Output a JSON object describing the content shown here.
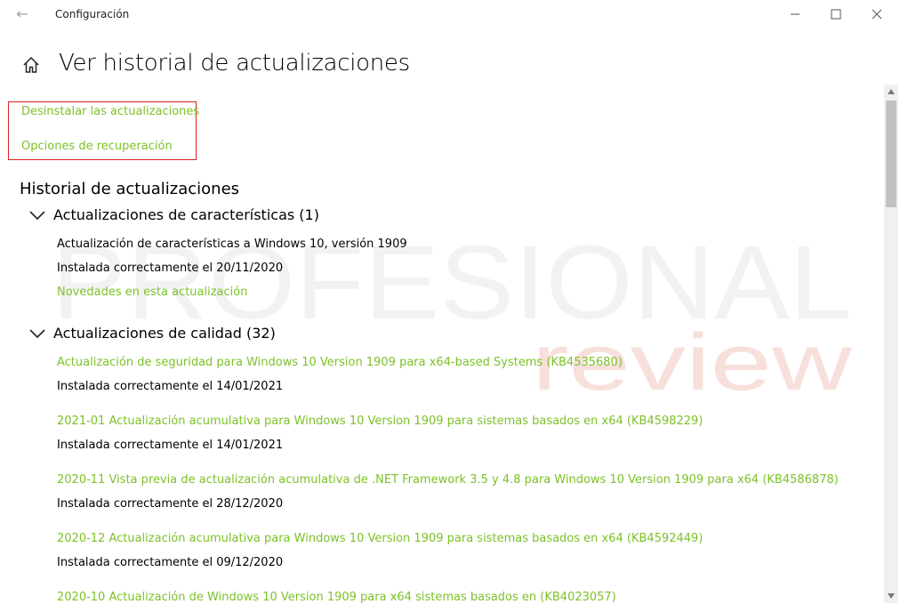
{
  "window": {
    "title": "Configuración",
    "back_icon": "←",
    "controls": [
      "minimize-icon",
      "maximize-icon",
      "close-icon"
    ]
  },
  "header": {
    "home_icon": "home-icon",
    "title": "Ver historial de actualizaciones"
  },
  "links": {
    "uninstall": "Desinstalar las actualizaciones",
    "recovery": "Opciones de recuperación",
    "highlight_color": "#e02020"
  },
  "history": {
    "title": "Historial de actualizaciones",
    "features": {
      "label": "Actualizaciones de características (1)",
      "items": [
        {
          "name": "Actualización de características a Windows 10, versión 1909",
          "status": "Instalada correctamente el 20/11/2020",
          "link": "Novedades en esta actualización"
        }
      ]
    },
    "quality": {
      "label": "Actualizaciones de calidad (32)",
      "items": [
        {
          "name": "Actualización de seguridad para Windows 10 Version 1909 para x64-based Systems (KB4535680)",
          "status": "Instalada correctamente el 14/01/2021"
        },
        {
          "name": "2021-01 Actualización acumulativa para Windows 10 Version 1909 para sistemas basados en x64 (KB4598229)",
          "status": "Instalada correctamente el 14/01/2021"
        },
        {
          "name": "2020-11 Vista previa de actualización acumulativa de .NET Framework 3.5 y 4.8 para Windows 10 Version 1909 para x64 (KB4586878)",
          "status": "Instalada correctamente el 28/12/2020"
        },
        {
          "name": "2020-12 Actualización acumulativa para Windows 10 Version 1909 para sistemas basados en x64 (KB4592449)",
          "status": "Instalada correctamente el 09/12/2020"
        },
        {
          "name": "2020-10 Actualización de Windows 10 Version 1909 para x64 sistemas basados en (KB4023057)"
        }
      ]
    }
  },
  "watermark": {
    "line1": "PROFESIONAL",
    "line2": "review"
  },
  "colors": {
    "accent_green": "#7cc227",
    "watermark_gray": "#e6e6e6",
    "watermark_red": "#f4c9c2"
  }
}
